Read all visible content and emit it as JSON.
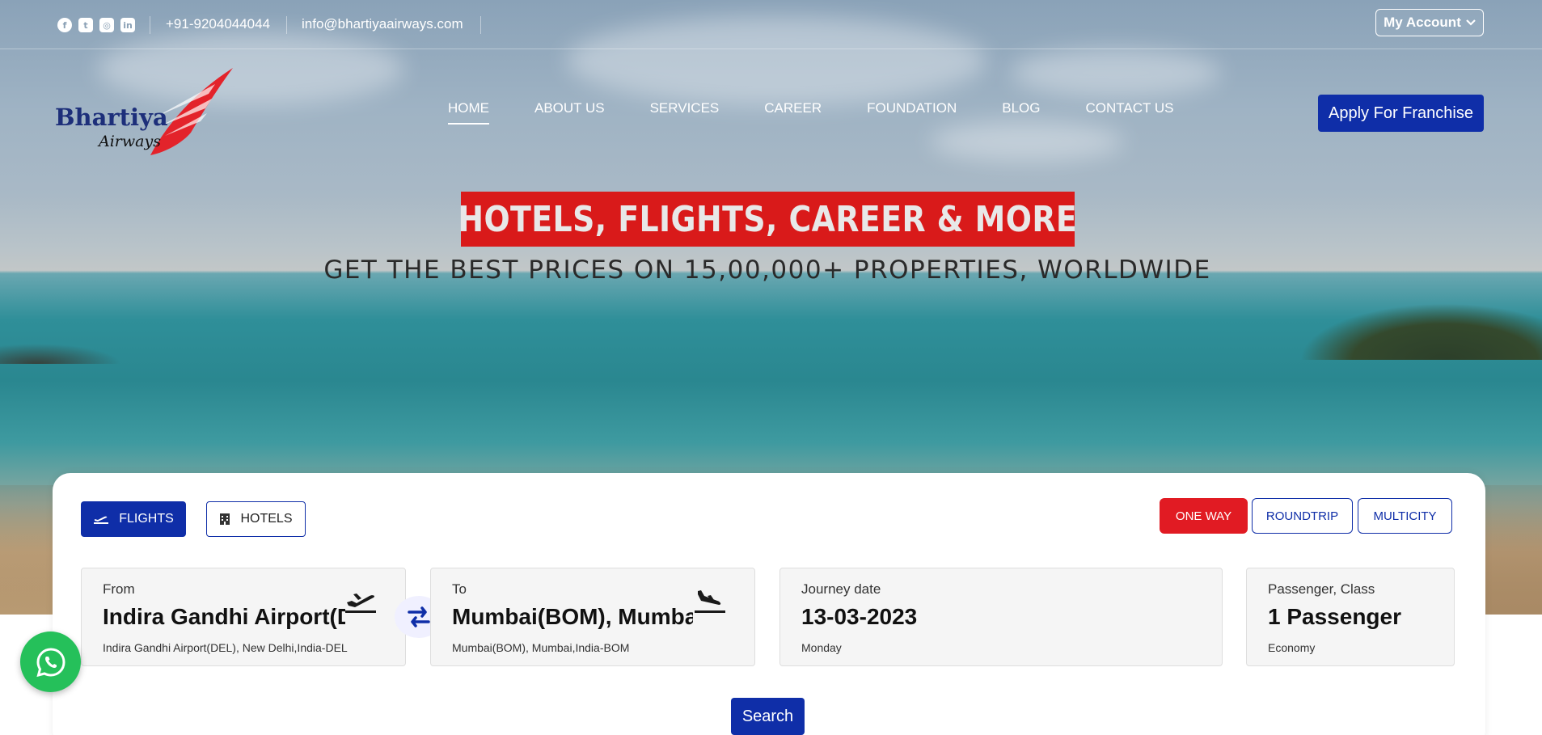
{
  "topbar": {
    "social_icons": [
      "facebook-icon",
      "twitter-icon",
      "instagram-icon",
      "linkedin-icon"
    ],
    "phone": "+91-9204044044",
    "email": "info@bhartiyaairways.com",
    "account_label": "My Account"
  },
  "logo": {
    "word": "Bhartiya",
    "sub": "Airways"
  },
  "nav": {
    "items": [
      {
        "label": "HOME"
      },
      {
        "label": "ABOUT US"
      },
      {
        "label": "SERVICES"
      },
      {
        "label": "CAREER"
      },
      {
        "label": "FOUNDATION"
      },
      {
        "label": "BLOG"
      },
      {
        "label": "CONTACT US"
      }
    ],
    "active": "HOME",
    "franchise_label": "Apply For Franchise"
  },
  "hero": {
    "headline": "HOTELS, FLIGHTS, CAREER & MORE",
    "subheadline": "GET THE BEST PRICES ON 15,00,000+ PROPERTIES, WORLDWIDE"
  },
  "search": {
    "tabs": {
      "flights": "FLIGHTS",
      "hotels": "HOTELS"
    },
    "trip_types": {
      "one_way": "ONE WAY",
      "roundtrip": "ROUNDTRIP",
      "multicity": "MULTICITY"
    },
    "selected_trip": "ONE WAY",
    "from": {
      "label": "From",
      "value": "Indira Gandhi Airport(DEL)",
      "sub": "Indira Gandhi Airport(DEL), New Delhi,India-DEL"
    },
    "to": {
      "label": "To",
      "value": "Mumbai(BOM), Mumbai",
      "sub": "Mumbai(BOM), Mumbai,India-BOM"
    },
    "date": {
      "label": "Journey date",
      "value": "13-03-2023",
      "sub": "Monday"
    },
    "passenger": {
      "label": "Passenger, Class",
      "value": "1 Passenger",
      "sub": "Economy"
    },
    "search_label": "Search"
  },
  "colors": {
    "brand_blue": "#0f2ea8",
    "brand_red": "#e11b23",
    "whatsapp_green": "#25c05a"
  }
}
